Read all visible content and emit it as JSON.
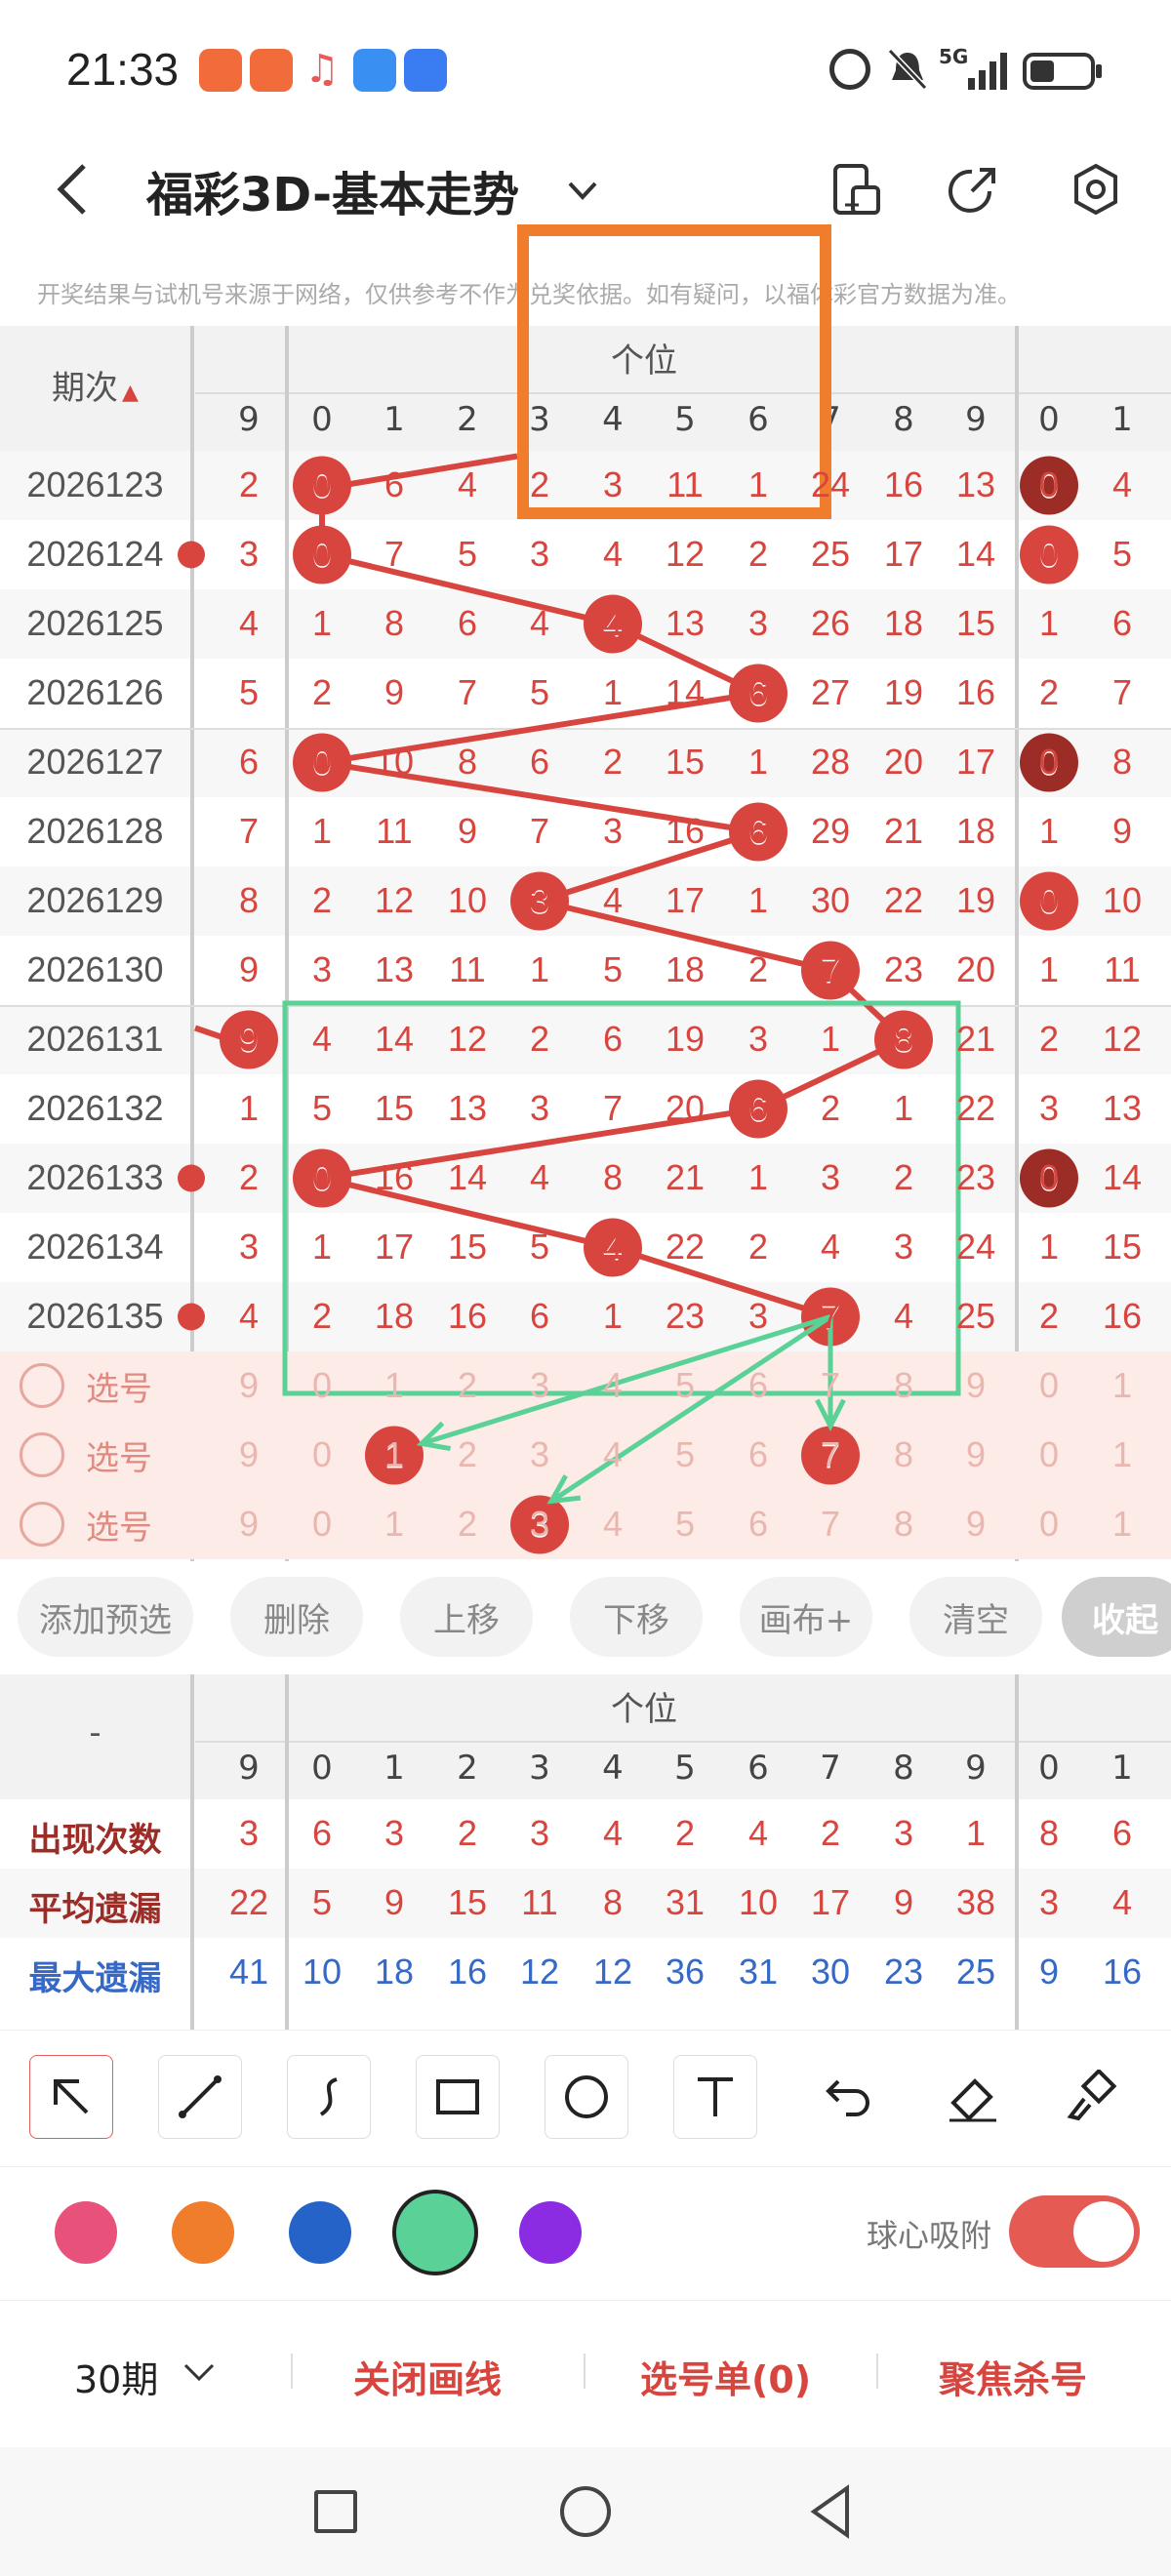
{
  "status": {
    "time": "21:33",
    "network": "5G"
  },
  "header": {
    "title": "福彩3D-基本走势"
  },
  "disclaimer": "开奖结果与试机号来源于网络，仅供参考不作为兑奖依据。如有疑问，以福体彩官方数据为准。",
  "grid": {
    "period_header": "期次",
    "section_title": "个位",
    "col_headers": [
      "9",
      "0",
      "1",
      "2",
      "3",
      "4",
      "5",
      "6",
      "7",
      "8",
      "9",
      "0",
      "1"
    ],
    "rows": [
      {
        "period": "2026123",
        "cells": [
          "2",
          "0",
          "6",
          "4",
          "2",
          "3",
          "11",
          "1",
          "24",
          "16",
          "13",
          "0",
          "4"
        ]
      },
      {
        "period": "2026124",
        "cells": [
          "3",
          "0",
          "7",
          "5",
          "3",
          "4",
          "12",
          "2",
          "25",
          "17",
          "14",
          "0",
          "5"
        ]
      },
      {
        "period": "2026125",
        "cells": [
          "4",
          "1",
          "8",
          "6",
          "4",
          "4",
          "13",
          "3",
          "26",
          "18",
          "15",
          "1",
          "6"
        ]
      },
      {
        "period": "2026126",
        "cells": [
          "5",
          "2",
          "9",
          "7",
          "5",
          "1",
          "14",
          "6",
          "27",
          "19",
          "16",
          "2",
          "7"
        ]
      },
      {
        "period": "2026127",
        "cells": [
          "6",
          "0",
          "10",
          "8",
          "6",
          "2",
          "15",
          "1",
          "28",
          "20",
          "17",
          "0",
          "8"
        ]
      },
      {
        "period": "2026128",
        "cells": [
          "7",
          "1",
          "11",
          "9",
          "7",
          "3",
          "16",
          "6",
          "29",
          "21",
          "18",
          "1",
          "9"
        ]
      },
      {
        "period": "2026129",
        "cells": [
          "8",
          "2",
          "12",
          "10",
          "3",
          "4",
          "17",
          "1",
          "30",
          "22",
          "19",
          "0",
          "10"
        ]
      },
      {
        "period": "2026130",
        "cells": [
          "9",
          "3",
          "13",
          "11",
          "1",
          "5",
          "18",
          "2",
          "7",
          "23",
          "20",
          "1",
          "11"
        ]
      },
      {
        "period": "2026131",
        "cells": [
          "9",
          "4",
          "14",
          "12",
          "2",
          "6",
          "19",
          "3",
          "1",
          "8",
          "21",
          "2",
          "12"
        ]
      },
      {
        "period": "2026132",
        "cells": [
          "1",
          "5",
          "15",
          "13",
          "3",
          "7",
          "20",
          "6",
          "2",
          "1",
          "22",
          "3",
          "13"
        ]
      },
      {
        "period": "2026133",
        "cells": [
          "2",
          "0",
          "16",
          "14",
          "4",
          "8",
          "21",
          "1",
          "3",
          "2",
          "23",
          "0",
          "14"
        ]
      },
      {
        "period": "2026134",
        "cells": [
          "3",
          "1",
          "17",
          "15",
          "5",
          "4",
          "22",
          "2",
          "4",
          "3",
          "24",
          "1",
          "15"
        ]
      },
      {
        "period": "2026135",
        "cells": [
          "4",
          "2",
          "18",
          "16",
          "6",
          "1",
          "23",
          "3",
          "7",
          "4",
          "25",
          "2",
          "16"
        ]
      }
    ],
    "select_rows": [
      {
        "label": "选号",
        "cells": [
          "9",
          "0",
          "1",
          "2",
          "3",
          "4",
          "5",
          "6",
          "7",
          "8",
          "9",
          "0",
          "1"
        ]
      },
      {
        "label": "选号",
        "cells": [
          "9",
          "0",
          "1",
          "2",
          "3",
          "4",
          "5",
          "6",
          "7",
          "8",
          "9",
          "0",
          "1"
        ]
      },
      {
        "label": "选号",
        "cells": [
          "9",
          "0",
          "1",
          "2",
          "3",
          "4",
          "5",
          "6",
          "7",
          "8",
          "9",
          "0",
          "1"
        ]
      }
    ]
  },
  "buttons": [
    "添加预选",
    "删除",
    "上移",
    "下移",
    "画布+",
    "清空",
    "收起"
  ],
  "stats": {
    "section_title": "个位",
    "dash": "-",
    "col_headers": [
      "9",
      "0",
      "1",
      "2",
      "3",
      "4",
      "5",
      "6",
      "7",
      "8",
      "9",
      "0",
      "1"
    ],
    "rows": [
      {
        "label": "出现次数",
        "values": [
          "3",
          "6",
          "3",
          "2",
          "3",
          "4",
          "2",
          "4",
          "2",
          "3",
          "1",
          "8",
          "6"
        ]
      },
      {
        "label": "平均遗漏",
        "values": [
          "22",
          "5",
          "9",
          "15",
          "11",
          "8",
          "31",
          "10",
          "17",
          "9",
          "38",
          "3",
          "4"
        ]
      },
      {
        "label": "最大遗漏",
        "values": [
          "41",
          "10",
          "18",
          "16",
          "12",
          "12",
          "36",
          "31",
          "30",
          "23",
          "25",
          "9",
          "16"
        ]
      }
    ]
  },
  "tools": [
    "select-arrow",
    "line",
    "curve",
    "rectangle",
    "circle",
    "text",
    "undo",
    "eraser",
    "brush"
  ],
  "colors": {
    "pink": "#e8527a",
    "orange": "#ef7d2c",
    "blue": "#2563c9",
    "green": "#5ad197",
    "purple": "#8b2be2",
    "accent_red": "#d8453f",
    "dark_red": "#9b2c26",
    "stat_blue": "#3568c7"
  },
  "snap": {
    "label": "球心吸附"
  },
  "actions": {
    "periods": "30期",
    "close_draw": "关闭画线",
    "selection": "选号单(0)",
    "focus_kill": "聚焦杀号"
  }
}
